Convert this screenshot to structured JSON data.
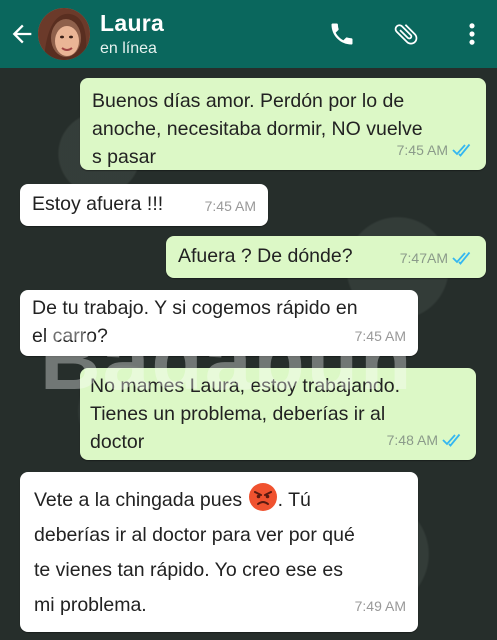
{
  "header": {
    "contact_name": "Laura",
    "status": "en línea",
    "colors": {
      "bar": "#0a675d",
      "outgoing": "#dcf8c6",
      "incoming": "#ffffff",
      "read_ticks": "#34b7f1"
    },
    "icons": [
      "back-arrow-icon",
      "avatar",
      "phone-icon",
      "paperclip-icon",
      "more-vert-icon"
    ]
  },
  "watermark": "Badabun",
  "messages": [
    {
      "dir": "out",
      "text": "Buenos días amor. Perdón por lo de\nanoche, necesitaba dormir, NO vuelve\ns pasar",
      "time": "7:45 AM",
      "read": true
    },
    {
      "dir": "in",
      "text": "Estoy afuera !!!",
      "time": "7:45 AM"
    },
    {
      "dir": "out",
      "text": "Afuera ? De dónde?",
      "time": "7:47AM",
      "read": true
    },
    {
      "dir": "in",
      "text": "De tu trabajo. Y si cogemos rápido en\nel carro?",
      "time": "7:45 AM"
    },
    {
      "dir": "out",
      "text": "No mames Laura, estoy trabajando.\nTienes un problema, deberías ir al\ndoctor",
      "time": "7:48 AM",
      "read": true
    },
    {
      "dir": "in",
      "text_before_emoji": "Vete a la chingada pues",
      "emoji": "angry-face-emoji",
      "text_after_emoji": ". Tú\ndeberías ir al doctor para ver por qué\nte vienes tan rápido. Yo creo ese es\nmi problema.",
      "time": "7:49 AM"
    }
  ]
}
